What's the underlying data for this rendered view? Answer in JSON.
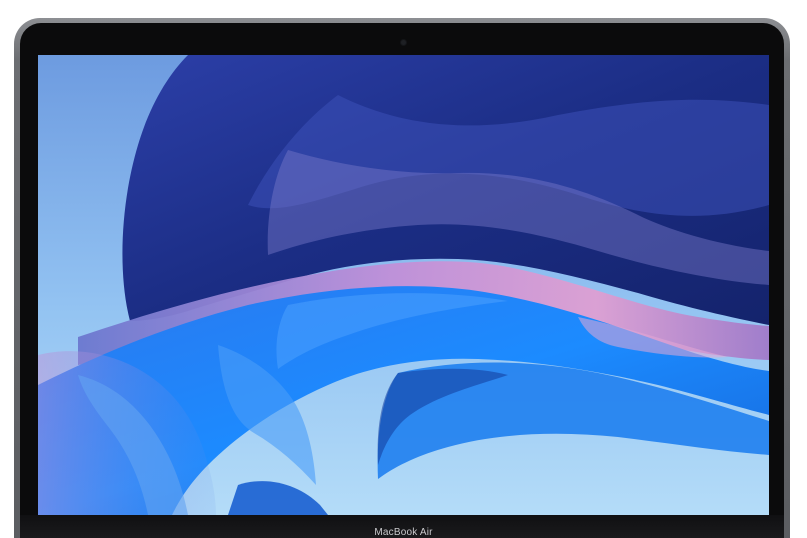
{
  "device": {
    "model_label": "MacBook Air"
  },
  "wallpaper": {
    "description_colors": {
      "sky_top": "#6f9fe0",
      "sky_bottom": "#a9d6f7",
      "deep_blue": "#1a2f86",
      "mid_blue": "#2f5fd6",
      "bright_blue": "#1e8fff",
      "pink": "#d79ad6"
    }
  },
  "colors": {
    "bezel": "#0b0b0c",
    "shell": "#6c6e72",
    "label": "#c9c9cc"
  }
}
